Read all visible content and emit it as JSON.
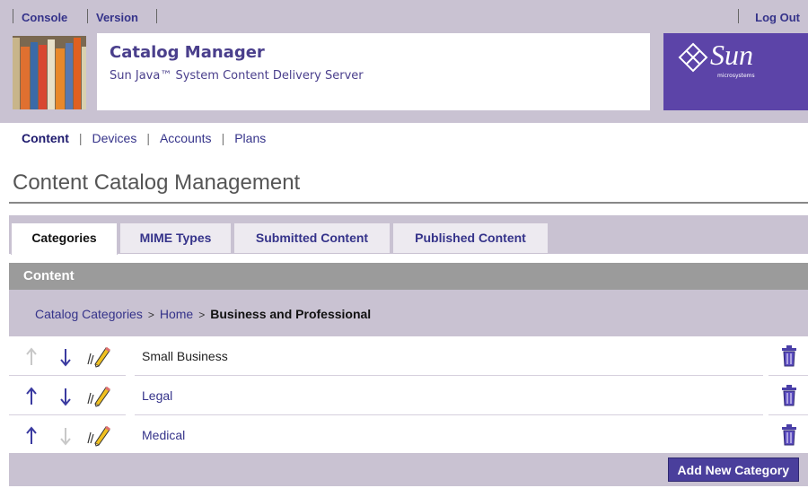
{
  "util_nav": {
    "console": "Console",
    "version": "Version",
    "logout": "Log Out"
  },
  "brand": {
    "title": "Catalog Manager",
    "subtitle": "Sun Java™ System Content Delivery Server",
    "vendor_logo": "Sun",
    "vendor_small": "microsystems"
  },
  "main_nav": {
    "items": [
      {
        "label": "Content",
        "active": true
      },
      {
        "label": "Devices",
        "active": false
      },
      {
        "label": "Accounts",
        "active": false
      },
      {
        "label": "Plans",
        "active": false
      }
    ]
  },
  "page_title": "Content Catalog Management",
  "tabs": [
    {
      "label": "Categories",
      "active": true
    },
    {
      "label": "MIME Types",
      "active": false
    },
    {
      "label": "Submitted Content",
      "active": false
    },
    {
      "label": "Published Content",
      "active": false
    }
  ],
  "panel": {
    "heading": "Content",
    "breadcrumb": {
      "items": [
        "Catalog Categories",
        "Home"
      ],
      "separator": ">",
      "current": "Business and Professional"
    },
    "rows": [
      {
        "label": "Small Business",
        "is_link": false,
        "up_enabled": false,
        "down_enabled": true
      },
      {
        "label": "Legal",
        "is_link": true,
        "up_enabled": true,
        "down_enabled": true
      },
      {
        "label": "Medical",
        "is_link": true,
        "up_enabled": true,
        "down_enabled": false
      }
    ],
    "add_button": "Add New Category"
  },
  "icons": {
    "move_up": "arrow-up-icon",
    "move_down": "arrow-down-icon",
    "edit": "pencil-icon",
    "delete": "trash-icon"
  },
  "colors": {
    "masthead_bg": "#c9c2d2",
    "brand_purple": "#5c44a8",
    "link": "#35338a",
    "button_bg": "#4a3f9c",
    "panel_header": "#9b9b9b"
  }
}
